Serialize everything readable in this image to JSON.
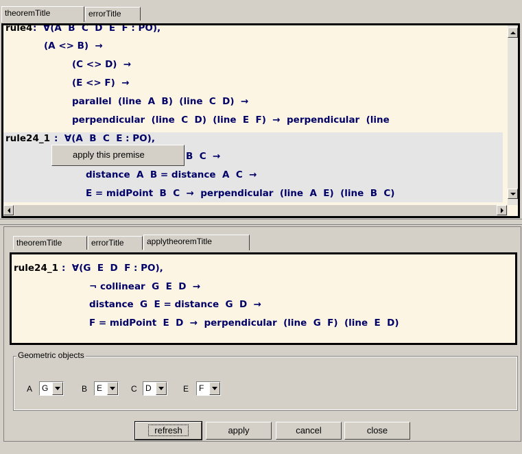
{
  "top_tabs": [
    "theoremTitle",
    "errorTitle"
  ],
  "top_editor": {
    "lines": [
      {
        "label": "rule4",
        "text": ":  ∀(A  B  C  D  E  F : PO),"
      },
      {
        "text": "(A <> B)  →"
      },
      {
        "text": "(C <> D)  →"
      },
      {
        "text": "(E <> F)  →"
      },
      {
        "text": "parallel  (line  A  B)  (line  C  D)  →"
      },
      {
        "text": "perpendicular  (line  C  D)  (line  E  F)  →  perpendicular  (line"
      },
      {
        "label": "rule24_1",
        "text": ":  ∀(A  B  C  E : PO),"
      },
      {
        "text": "B  C  →"
      },
      {
        "text": "distance  A  B = distance  A  C  →"
      },
      {
        "text": "E = midPoint  B  C  →  perpendicular  (line  A  E)  (line  B  C)"
      }
    ],
    "context_menu_item": "apply this premise"
  },
  "bottom_tabs": [
    "theoremTitle",
    "errorTitle",
    "applytheoremTitle"
  ],
  "bottom_editor": {
    "lines": [
      {
        "label": "rule24_1",
        "text": ":  ∀(G  E  D  F : PO),"
      },
      {
        "text": "¬ collinear  G  E  D  →"
      },
      {
        "text": "distance  G  E = distance  G  D  →"
      },
      {
        "text": "F = midPoint  E  D  →  perpendicular  (line  G  F)  (line  E  D)"
      }
    ]
  },
  "geometric_objects": {
    "legend": "Geometric objects",
    "items": [
      {
        "label": "A",
        "value": "G"
      },
      {
        "label": "B",
        "value": "E"
      },
      {
        "label": "C",
        "value": "D"
      },
      {
        "label": "E",
        "value": "F"
      }
    ]
  },
  "buttons": {
    "refresh": "refresh",
    "apply": "apply",
    "cancel": "cancel",
    "close": "close"
  }
}
